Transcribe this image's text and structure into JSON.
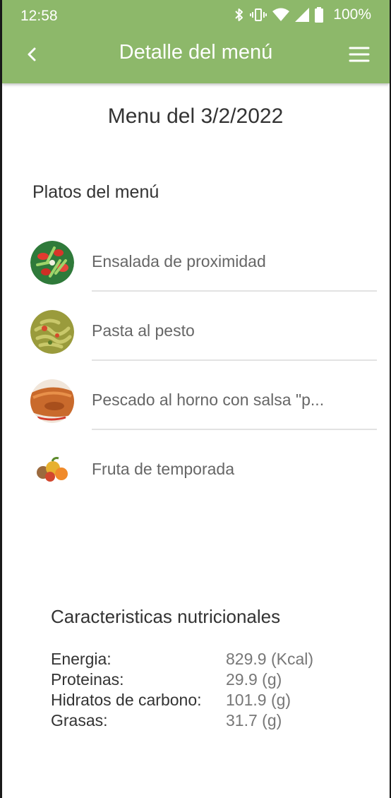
{
  "status_bar": {
    "time": "12:58",
    "battery": "100%"
  },
  "app_bar": {
    "title": "Detalle del menú"
  },
  "menu": {
    "heading": "Menu del 3/2/2022",
    "section_title": "Platos del menú",
    "dishes": [
      {
        "name": "Ensalada de proximidad"
      },
      {
        "name": "Pasta al pesto"
      },
      {
        "name": "Pescado al horno con salsa \"p..."
      },
      {
        "name": "Fruta de temporada"
      }
    ]
  },
  "nutrition": {
    "title": "Caracteristicas nutricionales",
    "rows": [
      {
        "label": "Energia:",
        "value": "829.9 (Kcal)"
      },
      {
        "label": "Proteinas:",
        "value": "29.9 (g)"
      },
      {
        "label": "Hidratos de carbono:",
        "value": "101.9 (g)"
      },
      {
        "label": "Grasas:",
        "value": "31.7 (g)"
      }
    ]
  },
  "colors": {
    "app_bar": "#8db86a",
    "text": "#333333",
    "muted": "#777777"
  }
}
